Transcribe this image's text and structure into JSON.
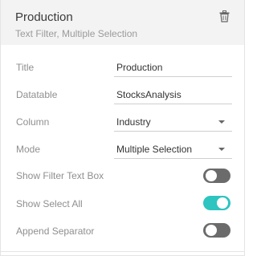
{
  "header": {
    "title": "Production",
    "subtitle": "Text Filter, Multiple Selection",
    "delete_icon": "trash-icon"
  },
  "fields": {
    "title": {
      "label": "Title",
      "value": "Production"
    },
    "datatable": {
      "label": "Datatable",
      "value": "StocksAnalysis"
    },
    "column": {
      "label": "Column",
      "value": "Industry"
    },
    "mode": {
      "label": "Mode",
      "value": "Multiple Selection"
    }
  },
  "toggles": {
    "show_filter_text_box": {
      "label": "Show Filter Text Box",
      "on": false
    },
    "show_select_all": {
      "label": "Show Select All",
      "on": true
    },
    "append_separator": {
      "label": "Append Separator",
      "on": false
    }
  },
  "colors": {
    "toggle_on": "#2ec4c0",
    "toggle_off": "#6b6b6b",
    "header_bg": "#f3f3f3"
  }
}
